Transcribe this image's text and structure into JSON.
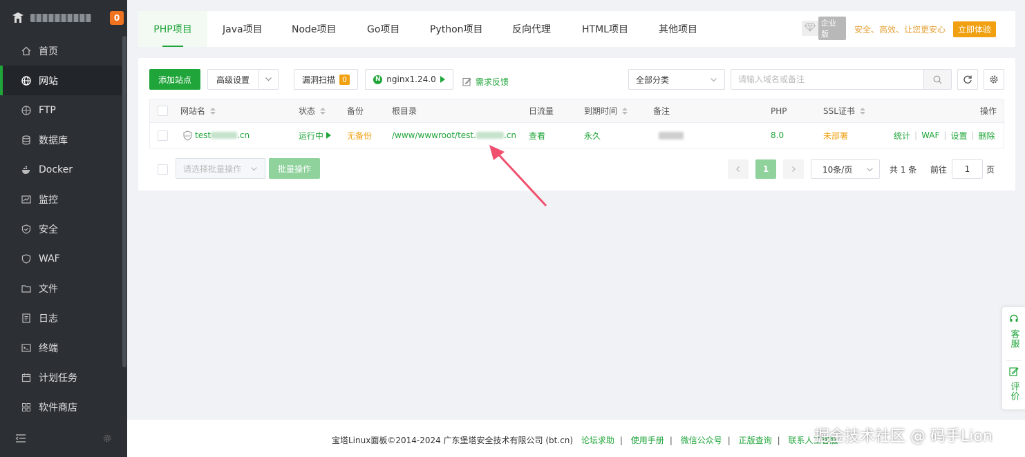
{
  "sidebar": {
    "badge": "0",
    "items": [
      {
        "label": "首页",
        "icon": "home-icon"
      },
      {
        "label": "网站",
        "icon": "globe-icon"
      },
      {
        "label": "FTP",
        "icon": "ftp-icon"
      },
      {
        "label": "数据库",
        "icon": "database-icon"
      },
      {
        "label": "Docker",
        "icon": "docker-icon"
      },
      {
        "label": "监控",
        "icon": "monitor-icon"
      },
      {
        "label": "安全",
        "icon": "shield-icon"
      },
      {
        "label": "WAF",
        "icon": "waf-icon"
      },
      {
        "label": "文件",
        "icon": "folder-icon"
      },
      {
        "label": "日志",
        "icon": "log-icon"
      },
      {
        "label": "终端",
        "icon": "terminal-icon"
      },
      {
        "label": "计划任务",
        "icon": "calendar-icon"
      },
      {
        "label": "软件商店",
        "icon": "apps-icon"
      }
    ],
    "active_index": 1
  },
  "tabs": [
    "PHP项目",
    "Java项目",
    "Node项目",
    "Go项目",
    "Python项目",
    "反向代理",
    "HTML项目",
    "其他项目"
  ],
  "enterprise": {
    "badge_label": "企业版",
    "slogan": "安全、高效、让您更安心",
    "button": "立即体验"
  },
  "toolbar": {
    "add_site": "添加站点",
    "advanced": "高级设置",
    "scan": "漏洞扫描",
    "scan_count": "0",
    "nginx": "nginx1.24.0",
    "feedback": "需求反馈",
    "category": "全部分类",
    "search_placeholder": "请输入域名或备注"
  },
  "table": {
    "headers": {
      "name": "网站名",
      "status": "状态",
      "backup": "备份",
      "root": "根目录",
      "traffic": "日流量",
      "expire": "到期时间",
      "remark": "备注",
      "php": "PHP",
      "ssl": "SSL证书",
      "ops": "操作"
    },
    "rows": [
      {
        "name_prefix": "test",
        "name_suffix": ".cn",
        "status": "运行中",
        "backup": "无备份",
        "root_prefix": "/www/wwwroot/test.",
        "root_suffix": ".cn",
        "traffic": "查看",
        "expire": "永久",
        "php": "8.0",
        "ssl": "未部署",
        "actions": [
          "统计",
          "WAF",
          "设置",
          "删除"
        ]
      }
    ]
  },
  "bottom": {
    "batch_placeholder": "请选择批量操作",
    "batch_button": "批量操作",
    "current_page": "1",
    "page_size": "10条/页",
    "total": "共 1 条",
    "goto_label": "前往",
    "goto_value": "1",
    "page_unit": "页"
  },
  "footer": {
    "copyright": "宝塔Linux面板©2014-2024 广东堡塔安全技术有限公司 (bt.cn)",
    "links": [
      "论坛求助",
      "使用手册",
      "微信公众号",
      "正版查询",
      "联系人工客服"
    ],
    "watermark": "掘金技术社区 @ 码手Lion"
  },
  "float": {
    "service": "客服",
    "rate": "评价"
  },
  "colors": {
    "accent": "#20a53a",
    "warn": "#f0a010",
    "sidebar": "#2c3035"
  }
}
